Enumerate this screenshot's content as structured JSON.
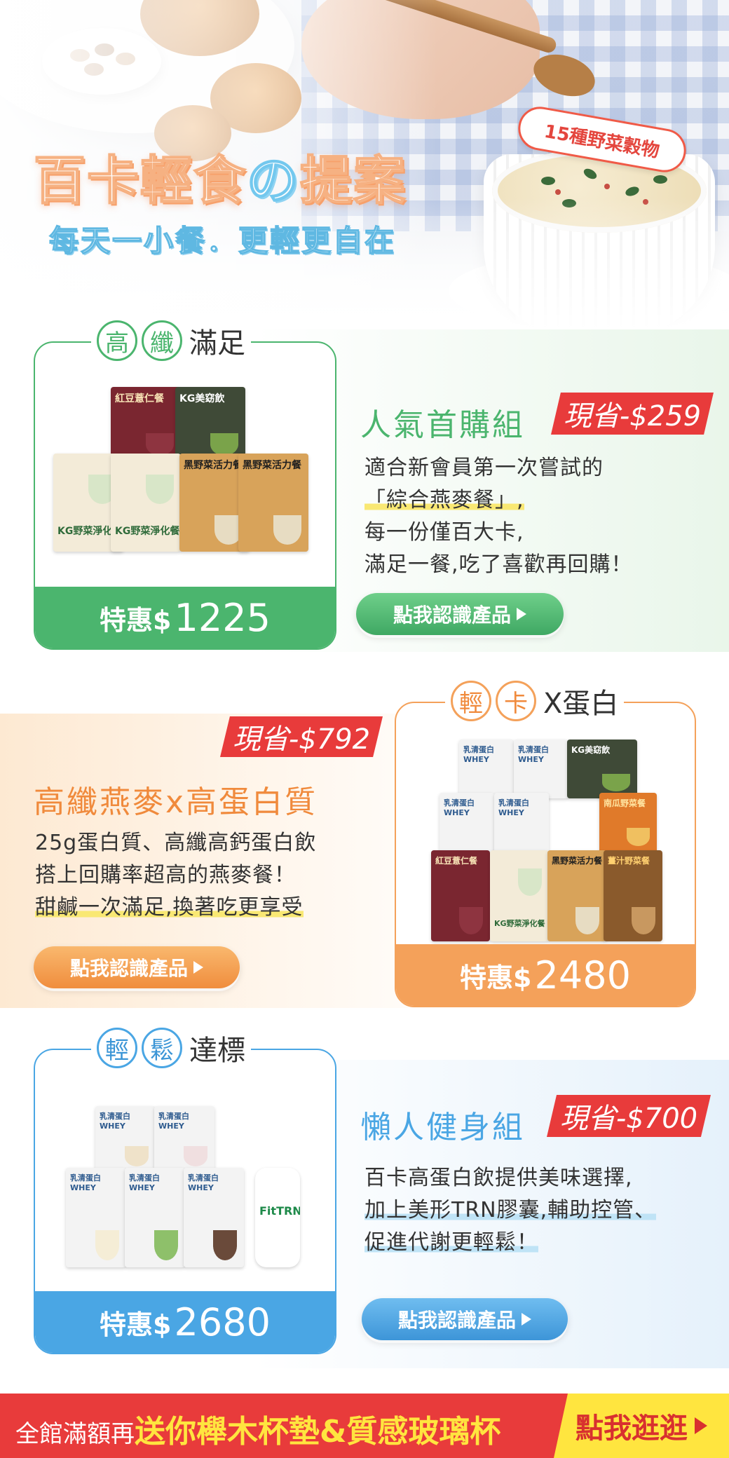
{
  "hero": {
    "title_main": "百卡輕食",
    "title_no": "の",
    "title_end": "提案",
    "subtitle": "每天一小餐．更輕更自在",
    "badge": "15種野菜穀物"
  },
  "sets": [
    {
      "head_chars": [
        "高",
        "纖"
      ],
      "head_text": "滿足",
      "title": "人氣首購組",
      "save": "現省-$259",
      "desc": [
        "適合新會員第一次嘗試的",
        "「綜合燕麥餐」,",
        "每一份僅百大卡,",
        "滿足一餐,吃了喜歡再回購！"
      ],
      "price_label": "特惠$",
      "price": "1225",
      "cta": "點我認識產品",
      "products": [
        "紅豆薏仁餐",
        "KG美窈飲",
        "KG野菜淨化餐",
        "KG野菜淨化餐",
        "黑野菜活力餐",
        "黑野菜活力餐"
      ]
    },
    {
      "head_chars": [
        "輕",
        "卡"
      ],
      "head_text": "X蛋白",
      "title": "高纖燕麥x高蛋白質",
      "save": "現省-$792",
      "desc": [
        "25g蛋白質、高纖高鈣蛋白飲",
        "搭上回購率超高的燕麥餐！",
        "甜鹹一次滿足,換著吃更享受"
      ],
      "price_label": "特惠$",
      "price": "2480",
      "cta": "點我認識產品",
      "products": [
        "乳清蛋白 WHEY",
        "乳清蛋白 WHEY",
        "KG美窈飲",
        "乳清蛋白 WHEY",
        "乳清蛋白 WHEY",
        "南瓜野菜餐",
        "紅豆薏仁餐",
        "KG野菜淨化餐",
        "黑野菜活力餐",
        "薑汁野菜餐"
      ]
    },
    {
      "head_chars": [
        "輕",
        "鬆"
      ],
      "head_text": "達標",
      "title": "懶人健身組",
      "save": "現省-$700",
      "desc": [
        "百卡高蛋白飲提供美味選擇,",
        "加上美形TRN膠囊,輔助控管、",
        "促進代謝更輕鬆！"
      ],
      "price_label": "特惠$",
      "price": "2680",
      "cta": "點我認識產品",
      "products": [
        "乳清蛋白 WHEY",
        "乳清蛋白 WHEY",
        "乳清蛋白 WHEY",
        "乳清蛋白 WHEY",
        "乳清蛋白 WHEY",
        "FitTRN"
      ]
    }
  ],
  "footer": {
    "prefix": "全館滿額再",
    "highlight": "送你櫸木杯墊&質感玻璃杯",
    "button": "點我逛逛"
  },
  "colors": {
    "green": "#4bb56e",
    "orange": "#f4a15a",
    "blue": "#4aa6e4",
    "red": "#e83b3b",
    "yellow": "#ffe53f"
  }
}
